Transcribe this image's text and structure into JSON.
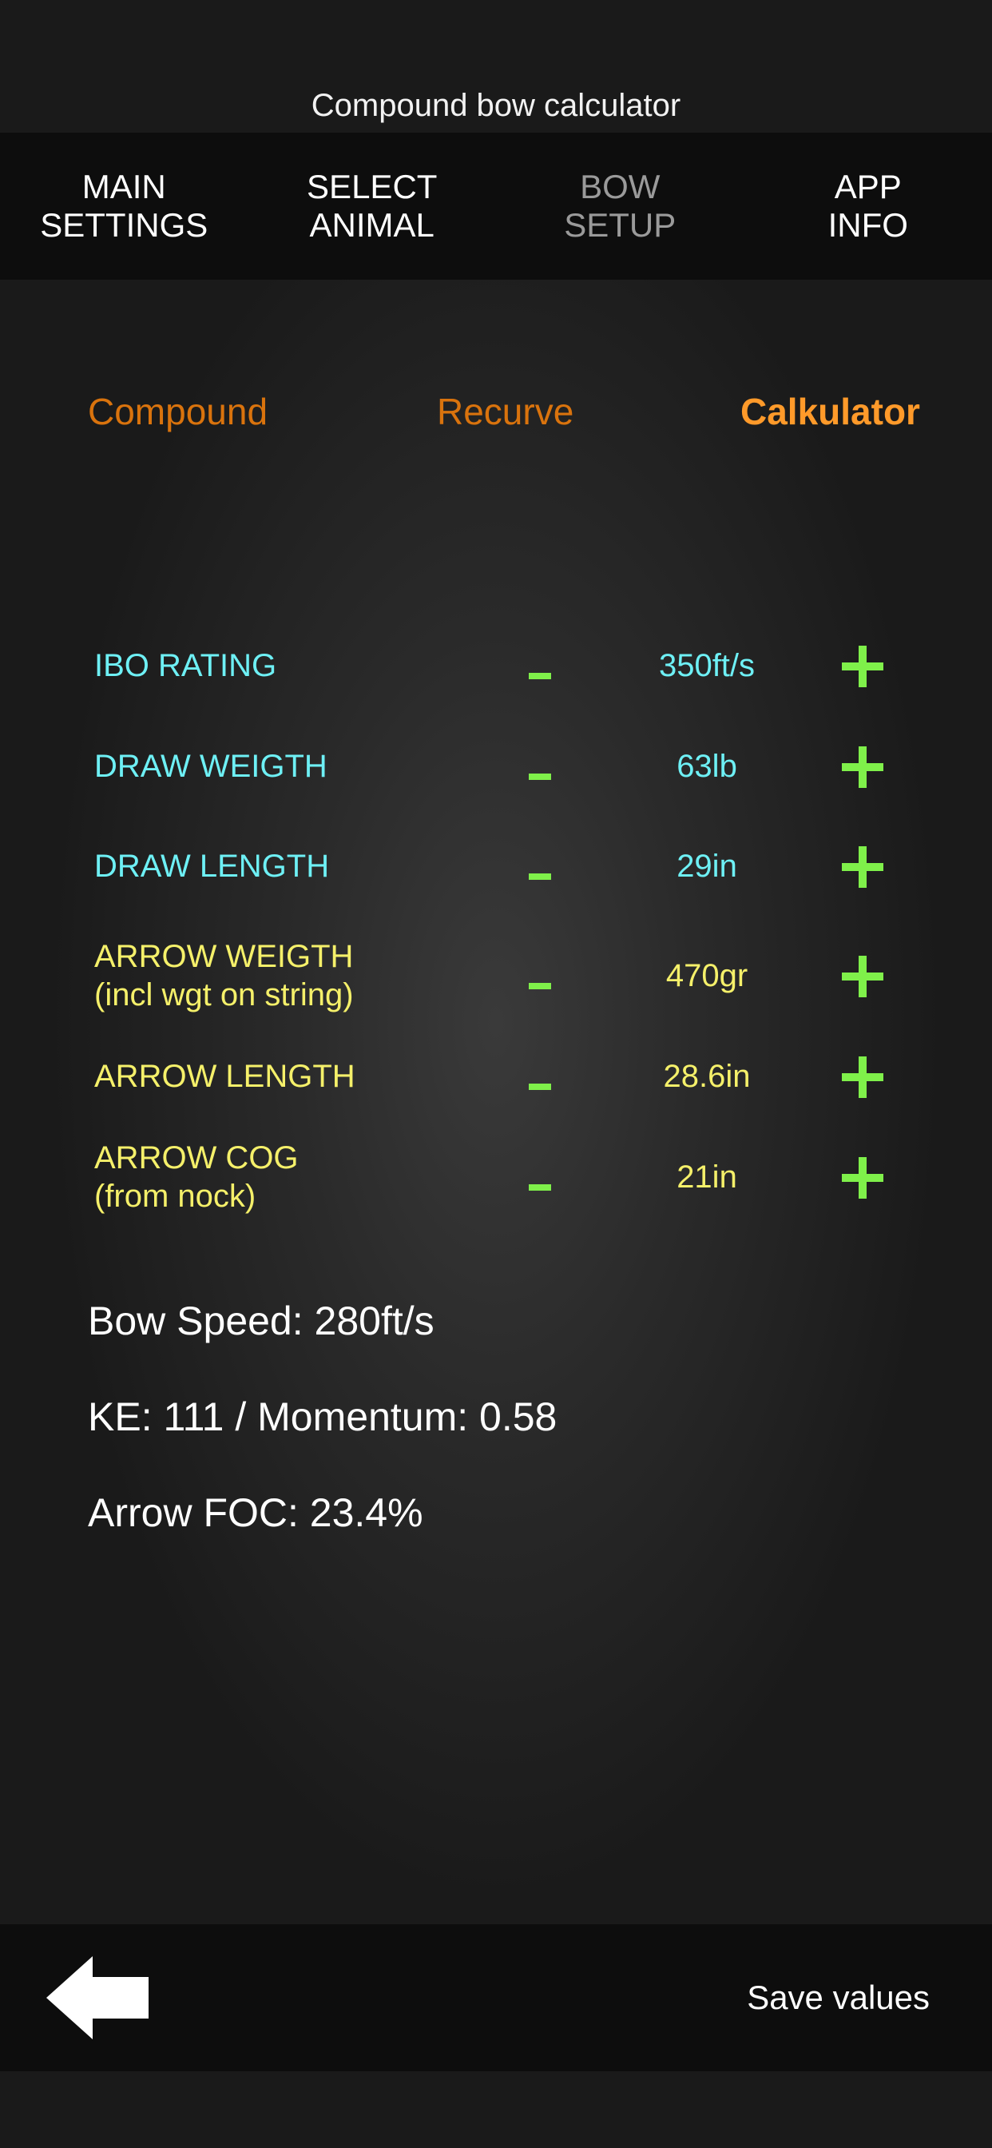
{
  "app": {
    "title": "Compound bow calculator"
  },
  "nav": {
    "tabs": [
      {
        "label": "MAIN\nSETTINGS"
      },
      {
        "label": "SELECT\nANIMAL"
      },
      {
        "label": "BOW\nSETUP"
      },
      {
        "label": "APP\nINFO"
      }
    ],
    "active_index": 2
  },
  "modes": {
    "compound": "Compound",
    "recurve": "Recurve",
    "calculator": "Calkulator",
    "active": "calculator"
  },
  "rows": [
    {
      "label": "IBO RATING",
      "sublabel": "",
      "value": "350ft/s",
      "color": "#6ef0f5"
    },
    {
      "label": "DRAW WEIGTH",
      "sublabel": "",
      "value": "63lb",
      "color": "#6ef0f5"
    },
    {
      "label": "DRAW LENGTH",
      "sublabel": "",
      "value": "29in",
      "color": "#6ef0f5"
    },
    {
      "label": "ARROW WEIGTH",
      "sublabel": "(incl wgt on string)",
      "value": "470gr",
      "color": "#f5f06a"
    },
    {
      "label": "ARROW LENGTH",
      "sublabel": "",
      "value": "28.6in",
      "color": "#f5f06a"
    },
    {
      "label": "ARROW COG",
      "sublabel": "(from nock)",
      "value": "21in",
      "color": "#f5f06a"
    }
  ],
  "results": {
    "bow_speed": "Bow Speed: 280ft/s",
    "ke_momentum": "KE: 111 / Momentum: 0.58",
    "arrow_foc": "Arrow FOC: 23.4%"
  },
  "footer": {
    "save_label": "Save values",
    "back_icon": "arrow-left-icon"
  },
  "colors": {
    "accent_green": "#7ff04a",
    "mode_orange": "#d9730d",
    "mode_orange_active": "#ff9a2a"
  }
}
